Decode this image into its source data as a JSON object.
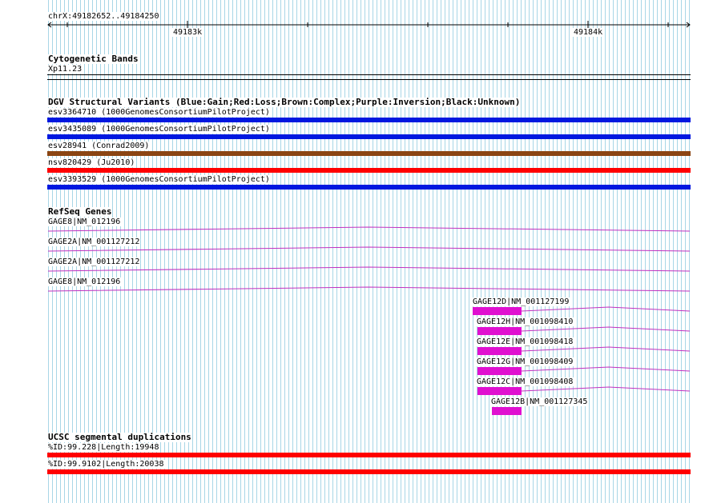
{
  "ruler": {
    "range_label": "chrX:49182652..49184250",
    "tick_labels": [
      "49183k",
      "49184k"
    ]
  },
  "cyto": {
    "title": "Cytogenetic Bands",
    "band": "Xp11.23"
  },
  "dgv": {
    "title": "DGV Structural Variants (Blue:Gain;Red:Loss;Brown:Complex;Purple:Inversion;Black:Unknown)",
    "variants": [
      {
        "label": "esv3364710 (1000GenomesConsortiumPilotProject)",
        "color": "#0018e0"
      },
      {
        "label": "esv3435089 (1000GenomesConsortiumPilotProject)",
        "color": "#0018e0"
      },
      {
        "label": "esv28941 (Conrad2009)",
        "color": "#8b4513"
      },
      {
        "label": "nsv820429 (Ju2010)",
        "color": "#ff0000"
      },
      {
        "label": "esv3393529 (1000GenomesConsortiumPilotProject)",
        "color": "#0018e0"
      }
    ]
  },
  "refseq": {
    "title": "RefSeq Genes",
    "genes": [
      {
        "label": "GAGE8|NM_012196"
      },
      {
        "label": "GAGE2A|NM_001127212"
      },
      {
        "label": "GAGE2A|NM_001127212"
      },
      {
        "label": "GAGE8|NM_012196"
      },
      {
        "label": "GAGE12D|NM_001127199"
      },
      {
        "label": "GAGE12H|NM_001098410"
      },
      {
        "label": "GAGE12E|NM_001098418"
      },
      {
        "label": "GAGE12G|NM_001098409"
      },
      {
        "label": "GAGE12C|NM_001098408"
      },
      {
        "label": "GAGE12B|NM_001127345"
      }
    ],
    "gene_color": "#c030c0",
    "exon_color": "#e010d0"
  },
  "segdups": {
    "title": "UCSC segmental duplications",
    "items": [
      {
        "label": "%ID:99.228|Length:19948",
        "color": "#ff0000"
      },
      {
        "label": "%ID:99.9102|Length:20038",
        "color": "#ff0000"
      }
    ]
  }
}
